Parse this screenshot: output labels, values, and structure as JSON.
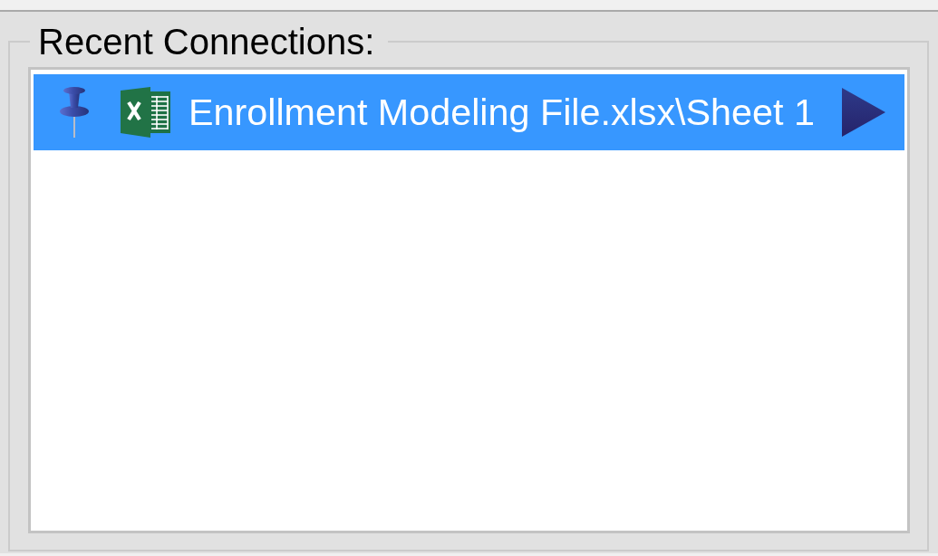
{
  "group": {
    "title": "Recent Connections:"
  },
  "connections": [
    {
      "name": "Enrollment Modeling File.xlsx\\Sheet 1",
      "selected": true,
      "pinned": true
    }
  ]
}
